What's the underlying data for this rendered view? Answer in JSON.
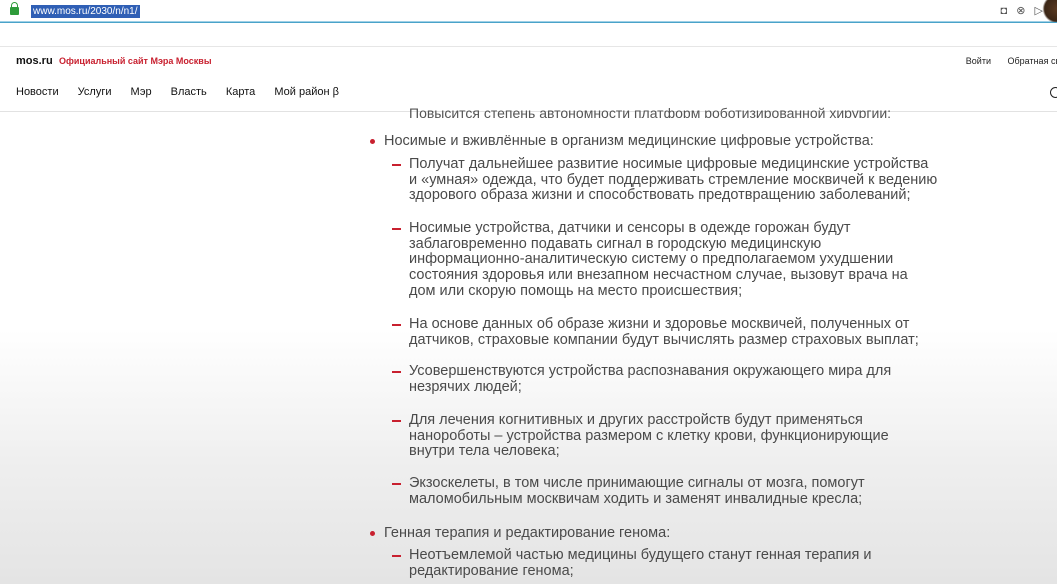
{
  "browser": {
    "url": "www.mos.ru/2030/n/n1/",
    "icons": [
      "camera-icon",
      "close-circle-icon",
      "send-icon"
    ]
  },
  "header": {
    "logo": "mos.ru",
    "tagline": "Официальный сайт Мэра Москвы",
    "login": "Войти",
    "feedback": "Обратная свя",
    "nav": [
      "Новости",
      "Услуги",
      "Мэр",
      "Власть",
      "Карта",
      "Мой район β"
    ]
  },
  "article": {
    "clipped_line": "Повысится степень автономности платформ роботизированной хирургии;",
    "sections": [
      {
        "title": "Носимые и вживлённые в организм медицинские цифровые устройства:",
        "items": [
          [
            "Получат дальнейшее развитие носимые цифровые медицинские устройства",
            "и «умная» одежда, что будет поддерживать стремление москвичей к ведению",
            "здорового образа жизни и способствовать предотвращению заболеваний;"
          ],
          [
            "Носимые устройства, датчики и сенсоры в одежде горожан будут",
            "заблаговременно подавать сигнал в городскую медицинскую",
            "информационно-аналитическую систему о предполагаемом ухудшении",
            "состояния здоровья или внезапном несчастном случае, вызовут врача на",
            "дом или скорую помощь на место происшествия;"
          ],
          [
            "На основе данных об образе жизни и здоровье москвичей, полученных от",
            "датчиков, страховые компании будут вычислять размер страховых выплат;"
          ],
          [
            "Усовершенствуются устройства распознавания окружающего мира для",
            "незрячих людей;"
          ],
          [
            "Для лечения когнитивных и других расстройств будут применяться",
            "нанороботы – устройства размером с клетку крови, функционирующие",
            "внутри тела человека;"
          ],
          [
            "Экзоскелеты, в том числе принимающие сигналы от мозга, помогут",
            "маломобильным москвичам ходить и заменят инвалидные кресла;"
          ]
        ]
      },
      {
        "title": "Генная терапия и редактирование генома:",
        "items": [
          [
            "Неотъемлемой частью медицины будущего станут генная терапия и",
            "редактирование генома;"
          ]
        ]
      }
    ]
  }
}
